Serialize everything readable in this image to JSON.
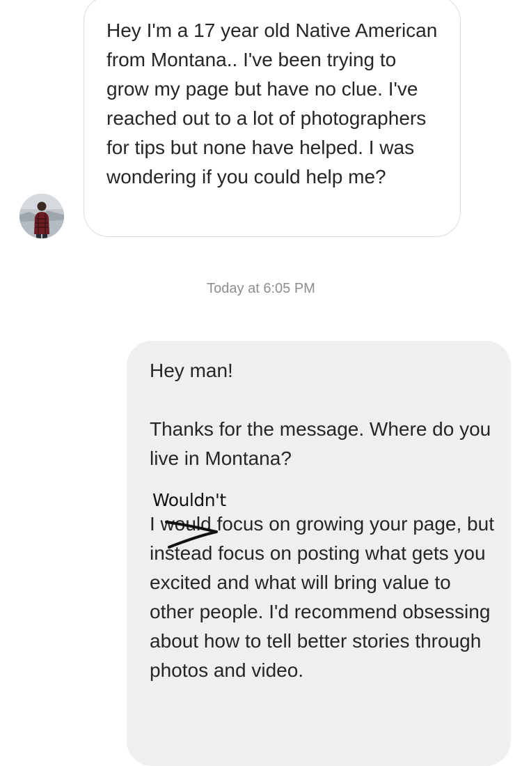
{
  "conversation": {
    "incoming_message": {
      "text": "Hey I'm a 17 year old Native American from Montana.. I've been trying to grow my page but have no clue. I've reached out to a lot of photographers for tips but none have helped. I was wondering if you could help me?"
    },
    "timestamp": "Today at 6:05 PM",
    "outgoing_message": {
      "paragraph_1": "Hey man!",
      "paragraph_2": "Thanks for the message. Where do you live in Montana?",
      "handwritten_correction": "Wouldn't",
      "paragraph_3": "I would focus on growing your page, but instead focus on posting what gets you excited and what will bring value to other people. I'd recommend obsessing about how to tell better stories through photos and video."
    }
  },
  "colors": {
    "incoming_bubble_border": "#dbdbdb",
    "outgoing_bubble_bg": "#efefef",
    "timestamp_text": "#8e8e8e",
    "message_text": "#262626"
  }
}
